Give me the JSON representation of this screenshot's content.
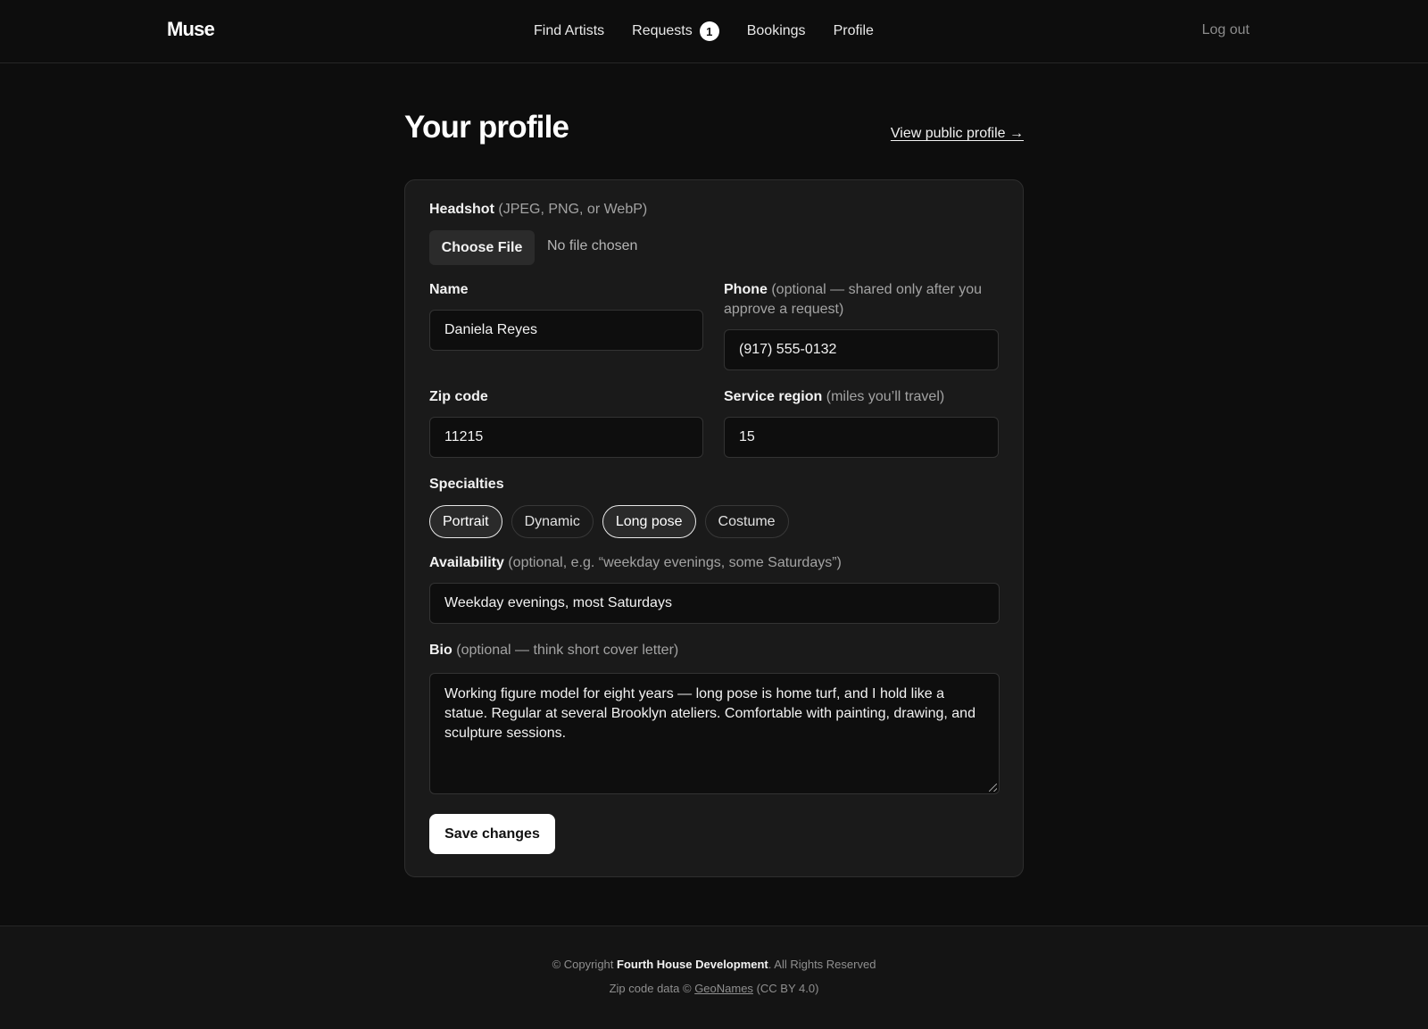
{
  "nav": {
    "brand": "Muse",
    "links": [
      {
        "label": "Find Artists"
      },
      {
        "label": "Requests",
        "badge": "1"
      },
      {
        "label": "Bookings"
      },
      {
        "label": "Profile"
      }
    ],
    "logout": "Log out"
  },
  "page": {
    "title": "Your profile",
    "public_link": "View public profile →"
  },
  "form": {
    "headshot": {
      "label": "Headshot",
      "hint": "(JPEG, PNG, or WebP)",
      "button": "Choose File",
      "status": "No file chosen"
    },
    "name": {
      "label": "Name",
      "value": "Daniela Reyes"
    },
    "phone": {
      "label": "Phone",
      "hint": "(optional — shared only after you approve a request)",
      "value": "(917) 555-0132"
    },
    "zip": {
      "label": "Zip code",
      "value": "11215"
    },
    "region": {
      "label": "Service region",
      "hint": "(miles you’ll travel)",
      "value": "15"
    },
    "specialties": {
      "label": "Specialties",
      "options": [
        {
          "label": "Portrait",
          "selected": true
        },
        {
          "label": "Dynamic",
          "selected": false
        },
        {
          "label": "Long pose",
          "selected": true
        },
        {
          "label": "Costume",
          "selected": false
        }
      ]
    },
    "availability": {
      "label": "Availability",
      "hint": "(optional, e.g. “weekday evenings, some Saturdays”)",
      "value": "Weekday evenings, most Saturdays"
    },
    "bio": {
      "label": "Bio",
      "hint": "(optional — think short cover letter)",
      "value": "Working figure model for eight years — long pose is home turf, and I hold like a statue. Regular at several Brooklyn ateliers. Comfortable with painting, drawing, and sculpture sessions."
    },
    "save": "Save changes"
  },
  "footer": {
    "copyright_prefix": "© Copyright",
    "company": "Fourth House Development",
    "rights": ". All Rights Reserved",
    "zip_prefix": "Zip code data ©",
    "zip_source": "GeoNames",
    "license": "(CC BY 4.0)"
  }
}
